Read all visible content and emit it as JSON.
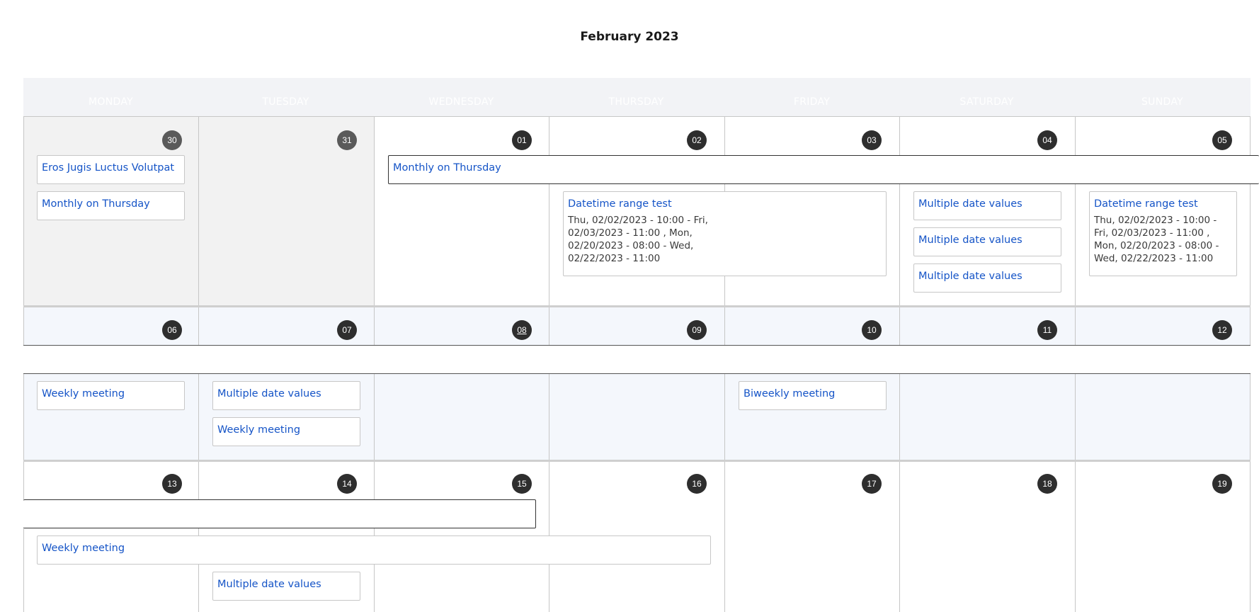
{
  "title": "February 2023",
  "weekdays": [
    "MONDAY",
    "TUESDAY",
    "WEDNESDAY",
    "THURSDAY",
    "FRIDAY",
    "SATURDAY",
    "SUNDAY"
  ],
  "days": {
    "w1": [
      "30",
      "31",
      "01",
      "02",
      "03",
      "04",
      "05"
    ],
    "w2": [
      "06",
      "07",
      "08",
      "09",
      "10",
      "11",
      "12"
    ],
    "w3": [
      "13",
      "14",
      "15",
      "16",
      "17",
      "18",
      "19"
    ]
  },
  "events": {
    "eros": "Eros Jugis Luctus Volutpat",
    "monthly_mon": "Monthly on Thursday",
    "monthly_span": "Monthly on Thursday",
    "datetime_title": "Datetime range test",
    "datetime_dates": "Thu, 02/02/2023 - 10:00 - Fri, 02/03/2023 - 11:00 , Mon, 02/20/2023 - 08:00 - Wed, 02/22/2023 - 11:00",
    "mdv_sat_1": "Multiple date values",
    "mdv_sat_2": "Multiple date values",
    "mdv_sat_3": "Multiple date values",
    "datetime_sun_title": "Datetime range test",
    "datetime_sun_dates": "Thu, 02/02/2023 - 10:00 - Fri, 02/03/2023 - 11:00 , Mon, 02/20/2023 - 08:00 - Wed, 02/22/2023 - 11:00",
    "weekly_mon": "Weekly meeting",
    "mdv_tue": "Multiple date values",
    "weekly_tue": "Weekly meeting",
    "biweekly_fri": "Biweekly meeting",
    "weekly_w3": "Weekly meeting",
    "mdv_tue_w3": "Multiple date values"
  },
  "colors": {
    "accent": "#1554c7",
    "badge": "#2e2e2e",
    "past_bg": "#f2f2f2",
    "week_band": "#f4f7fc"
  }
}
